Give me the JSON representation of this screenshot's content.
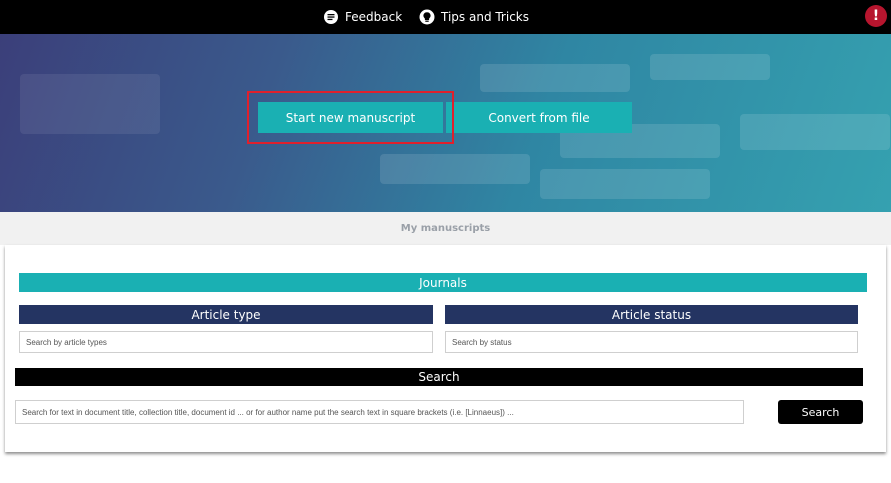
{
  "topbar": {
    "feedback_label": "Feedback",
    "tips_label": "Tips and Tricks",
    "alert_symbol": "!",
    "icons": {
      "feedback": "chat-bubble-icon",
      "tips": "lightbulb-icon",
      "alert": "exclamation-icon"
    }
  },
  "hero": {
    "start_label": "Start new manuscript",
    "convert_label": "Convert from file"
  },
  "tabs": {
    "my_manuscripts": "My manuscripts"
  },
  "filters": {
    "journals_label": "Journals",
    "article_type_label": "Article type",
    "article_type_placeholder": "Search by article types",
    "article_status_label": "Article status",
    "article_status_placeholder": "Search by status",
    "search_label": "Search",
    "search_placeholder": "Search for text in document title, collection title, document id ... or for author name put the search text in square brackets (i.e. [Linnaeus]) ...",
    "search_button_label": "Search"
  },
  "colors": {
    "accent_teal": "#1ab0b3",
    "navy": "#243462",
    "alert_red": "#b7152e",
    "highlight_red": "#e0202c"
  }
}
